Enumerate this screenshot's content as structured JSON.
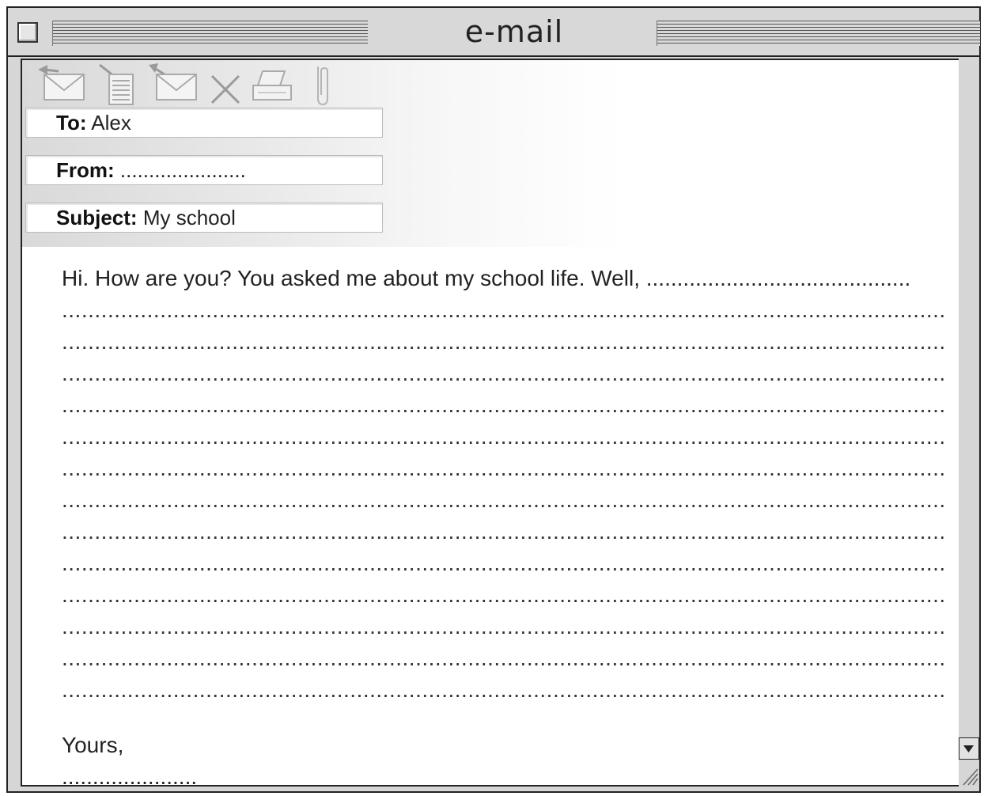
{
  "window": {
    "title": "e-mail"
  },
  "toolbar": {
    "icons": [
      "reply-icon",
      "new-note-icon",
      "forward-icon",
      "delete-icon",
      "print-icon",
      "attachment-icon"
    ]
  },
  "fields": {
    "to_label": "To:",
    "to_value": "Alex",
    "from_label": "From:",
    "from_value": "......................",
    "subject_label": "Subject:",
    "subject_value": "My school"
  },
  "message": {
    "first_line": "Hi. How are you? You asked me about my school life. Well, ...........................................",
    "lines": [
      "............................................................................................................................................",
      "............................................................................................................................................",
      "............................................................................................................................................",
      "............................................................................................................................................",
      "............................................................................................................................................",
      "............................................................................................................................................",
      "............................................................................................................................................",
      "............................................................................................................................................",
      "............................................................................................................................................",
      "............................................................................................................................................",
      "............................................................................................................................................",
      "............................................................................................................................................",
      "............................................................................................................................................"
    ],
    "closing": "Yours,",
    "signature": "......................"
  }
}
